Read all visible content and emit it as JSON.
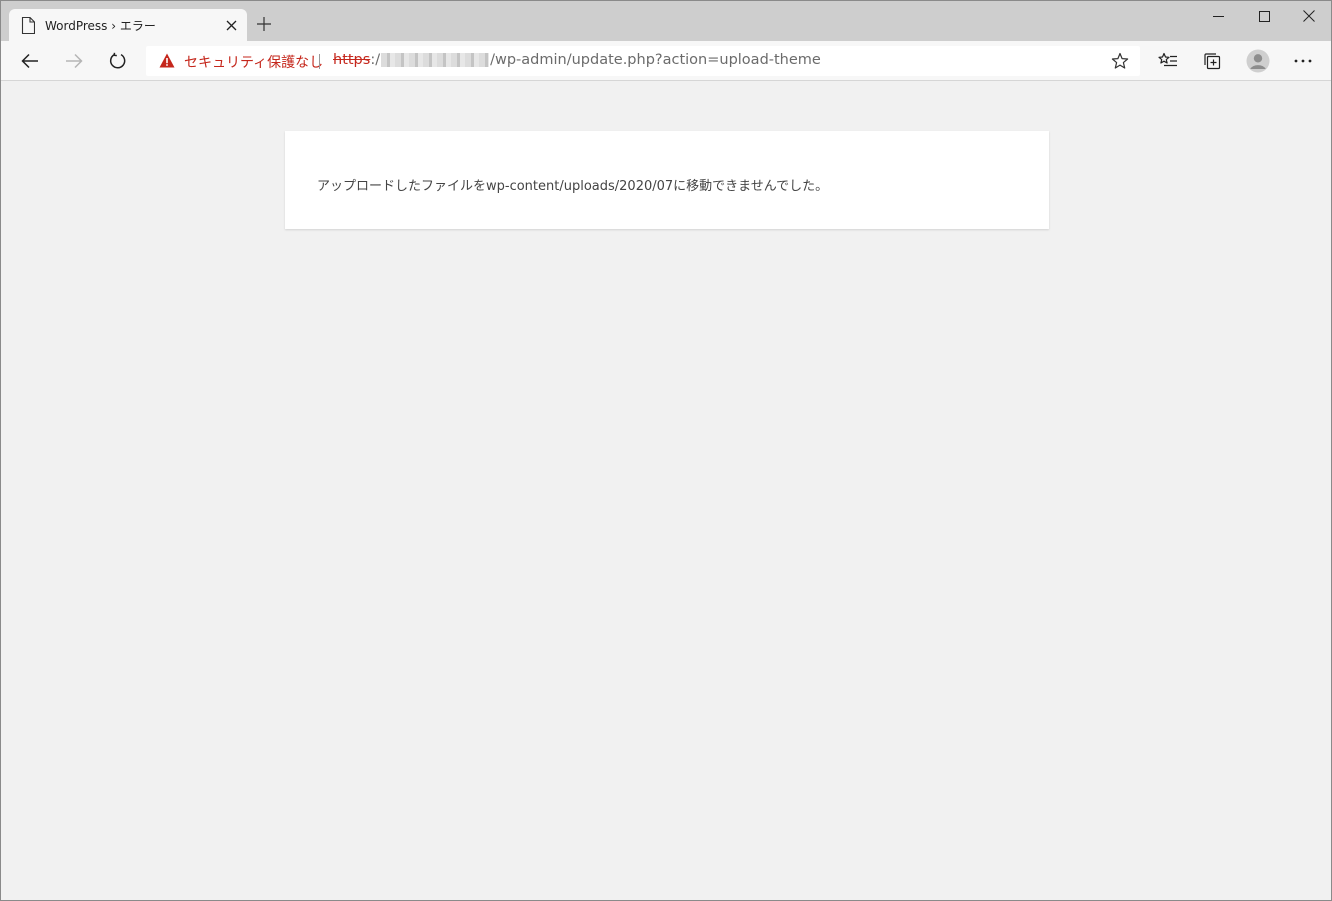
{
  "tab": {
    "title": "WordPress › エラー",
    "page_icon": "page-icon",
    "close_icon": "close-icon"
  },
  "new_tab_icon": "plus-icon",
  "window_controls": {
    "minimize_icon": "minimize-icon",
    "maximize_icon": "maximize-icon",
    "close_icon": "close-icon"
  },
  "toolbar": {
    "back_icon": "arrow-left-icon",
    "forward_icon": "arrow-right-icon",
    "refresh_icon": "refresh-icon",
    "favorites_icon": "favorites-list-icon",
    "collections_icon": "collections-icon",
    "profile_icon": "avatar-icon",
    "menu_icon": "more-icon"
  },
  "address": {
    "warning_icon": "warning-icon",
    "security_label": "セキュリティ保護なし",
    "url_scheme": "https",
    "url_scheme_sep": ":/",
    "url_path": "/wp-admin/update.php?action=upload-theme",
    "star_icon": "star-icon"
  },
  "page": {
    "error_message": "アップロードしたファイルをwp-content/uploads/2020/07に移動できませんでした。"
  },
  "colors": {
    "security_red": "#c5271c",
    "tabstrip": "#cecece",
    "toolbar": "#f7f7f7",
    "page_bg": "#f1f1f1"
  }
}
